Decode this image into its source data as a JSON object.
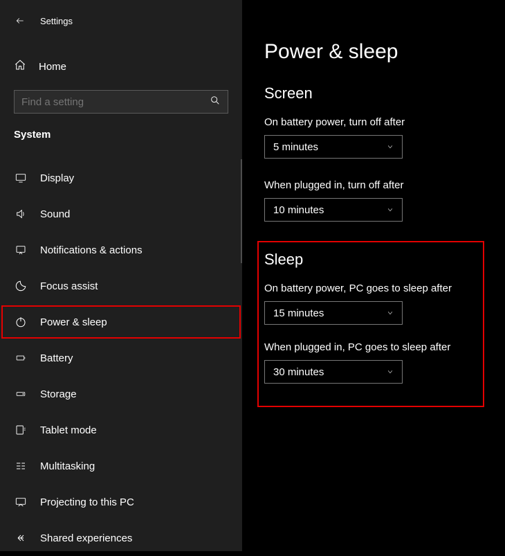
{
  "header": {
    "title": "Settings"
  },
  "home": {
    "label": "Home"
  },
  "search": {
    "placeholder": "Find a setting"
  },
  "category": "System",
  "nav": [
    {
      "label": "Display"
    },
    {
      "label": "Sound"
    },
    {
      "label": "Notifications & actions"
    },
    {
      "label": "Focus assist"
    },
    {
      "label": "Power & sleep"
    },
    {
      "label": "Battery"
    },
    {
      "label": "Storage"
    },
    {
      "label": "Tablet mode"
    },
    {
      "label": "Multitasking"
    },
    {
      "label": "Projecting to this PC"
    },
    {
      "label": "Shared experiences"
    }
  ],
  "page": {
    "title": "Power & sleep",
    "screen": {
      "heading": "Screen",
      "battery_label": "On battery power, turn off after",
      "battery_value": "5 minutes",
      "plugged_label": "When plugged in, turn off after",
      "plugged_value": "10 minutes"
    },
    "sleep": {
      "heading": "Sleep",
      "battery_label": "On battery power, PC goes to sleep after",
      "battery_value": "15 minutes",
      "plugged_label": "When plugged in, PC goes to sleep after",
      "plugged_value": "30 minutes"
    }
  }
}
